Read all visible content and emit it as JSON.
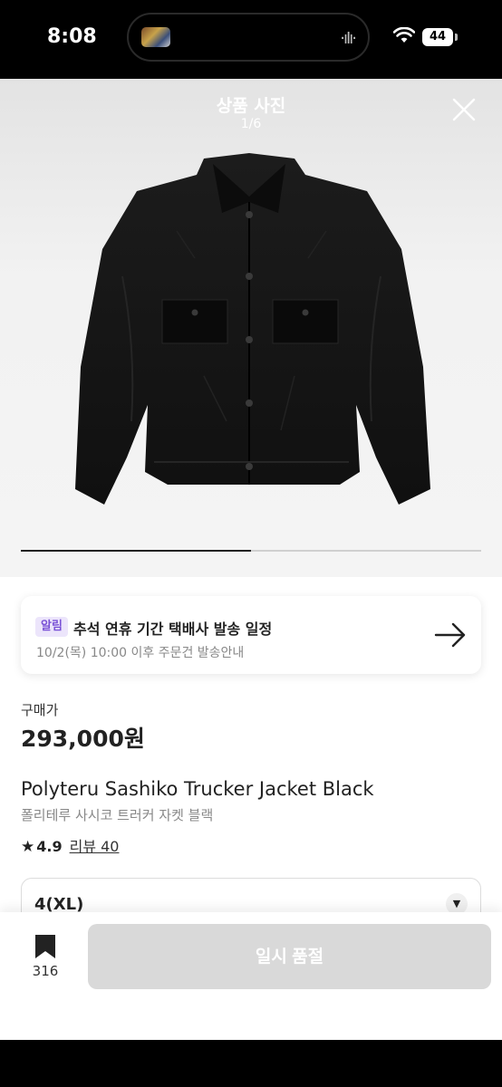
{
  "status_bar": {
    "time": "8:08",
    "battery": "44"
  },
  "gallery": {
    "title": "상품 사진",
    "counter": "1/6",
    "progress": 0.5
  },
  "notice": {
    "badge": "알림",
    "title": "추석 연휴 기간 택배사 발송 일정",
    "subtitle": "10/2(목) 10:00 이후 주문건 발송안내"
  },
  "product": {
    "price_label": "구매가",
    "price": "293,000원",
    "name_en": "Polyteru Sashiko Trucker Jacket Black",
    "name_ko": "폴리테루 사시코 트러커 자켓 블랙",
    "rating": "4.9",
    "review_label": "리뷰 40"
  },
  "size_select": {
    "value": "4(XL)"
  },
  "bottom_bar": {
    "bookmark_count": "316",
    "action_label": "일시 품절"
  }
}
